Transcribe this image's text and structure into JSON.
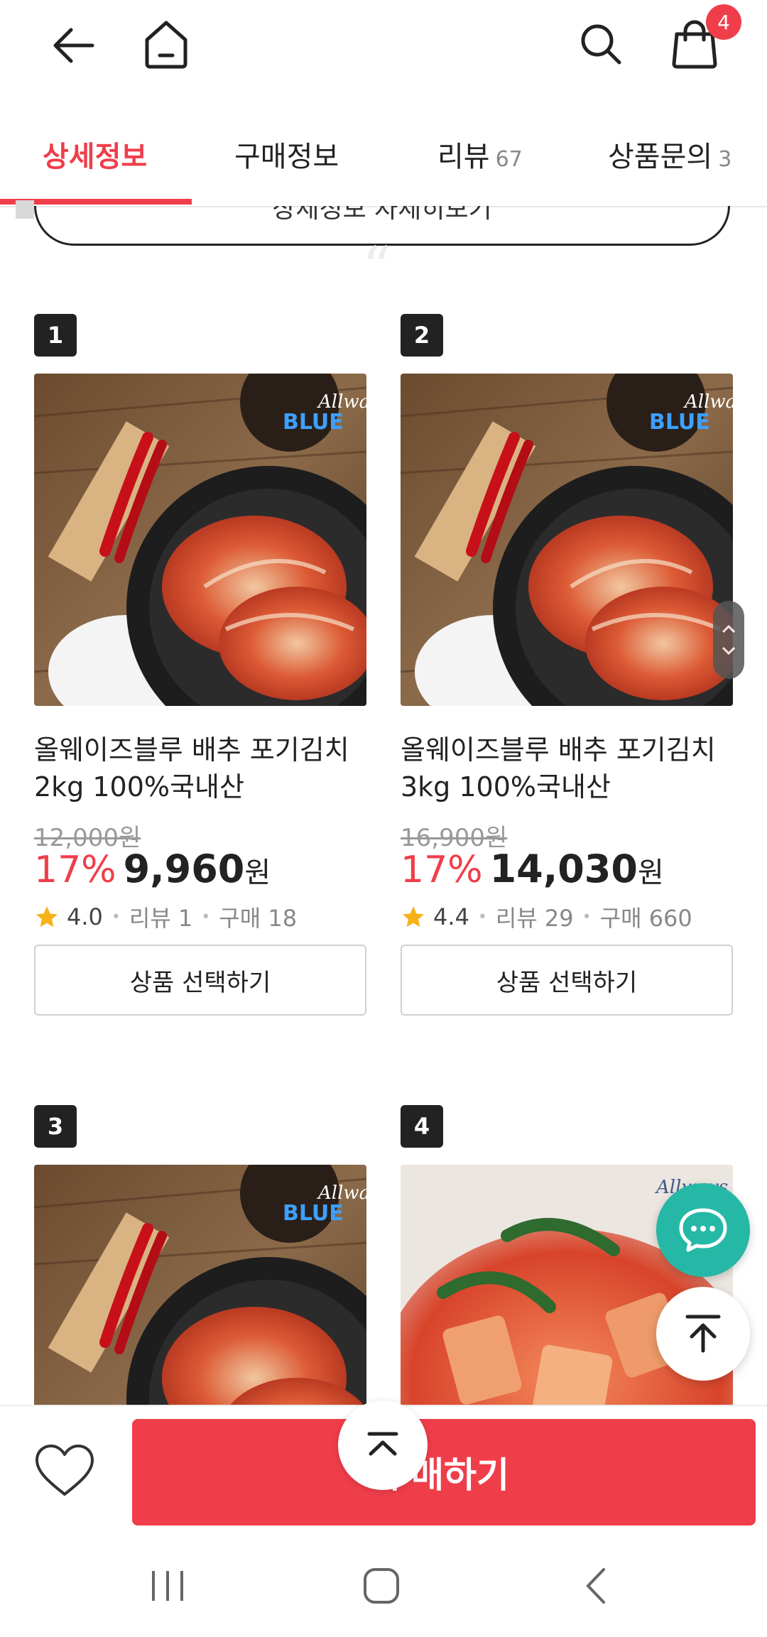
{
  "header": {
    "back_icon": "arrow-left-icon",
    "home_icon": "home-icon",
    "search_icon": "search-icon",
    "cart_icon": "shopping-bag-icon",
    "cart_badge": "4"
  },
  "tabs": [
    {
      "label": "상세정보",
      "count": ""
    },
    {
      "label": "구매정보",
      "count": ""
    },
    {
      "label": "리뷰",
      "count": "67"
    },
    {
      "label": "상품문의",
      "count": "3"
    }
  ],
  "detail_more_button": "상세정보 자세히보기",
  "products": [
    {
      "rank": "1",
      "name": "올웨이즈블루 배추 포기김치 2kg 100%국내산",
      "original_price": "12,000원",
      "discount": "17%",
      "price": "9,960",
      "currency": "원",
      "rating": "4.0",
      "reviews": "리뷰 1",
      "purchases": "구매 18",
      "select_label": "상품 선택하기",
      "image": "kimchi-bowl"
    },
    {
      "rank": "2",
      "name": "올웨이즈블루 배추 포기김치 3kg 100%국내산",
      "original_price": "16,900원",
      "discount": "17%",
      "price": "14,030",
      "currency": "원",
      "rating": "4.4",
      "reviews": "리뷰 29",
      "purchases": "구매 660",
      "select_label": "상품 선택하기",
      "image": "kimchi-bowl"
    },
    {
      "rank": "3",
      "image": "kimchi-bowl"
    },
    {
      "rank": "4",
      "image": "radish-kimchi"
    }
  ],
  "brand_watermark": "Allways BLUE 올웨이즈블루",
  "floating": {
    "chat_icon": "chat-bubble-icon",
    "top_icon": "scroll-top-icon",
    "collapse_icon": "chevron-up-icon"
  },
  "bottom_bar": {
    "wish_icon": "heart-icon",
    "buy_label": "구매하기"
  },
  "colors": {
    "accent": "#ef3e4a",
    "chat": "#26b8a6"
  }
}
